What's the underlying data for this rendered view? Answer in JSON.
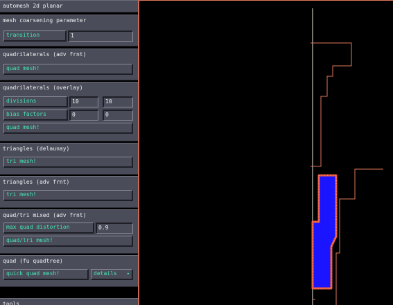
{
  "panel": {
    "title": "automesh 2d planar",
    "coarsening": {
      "title": "mesh coarsening parameter",
      "field_label": "transition",
      "field_value": "1"
    },
    "quad_adv": {
      "title": "quadrilaterals (adv frnt)",
      "button": "quad mesh!"
    },
    "quad_overlay": {
      "title": "quadrilaterals (overlay)",
      "divisions_label": "divisions",
      "divisions_1": "10",
      "divisions_2": "10",
      "bias_label": "bias factors",
      "bias_1": "0",
      "bias_2": "0",
      "button": "quad mesh!"
    },
    "tri_delaunay": {
      "title": "triangles (delaunay)",
      "button": "tri mesh!"
    },
    "tri_adv": {
      "title": "triangles (adv frnt)",
      "button": "tri mesh!"
    },
    "mixed": {
      "title": "quad/tri mixed (adv frnt)",
      "distortion_label": "max quad distortion",
      "distortion_value": "0.9",
      "button": "quad/tri mesh!"
    },
    "quadtree": {
      "title": "quad (fu quadtree)",
      "button": "quick quad mesh!",
      "details": "details"
    },
    "tools": {
      "title": "tools"
    }
  },
  "colors": {
    "panel_bg": "#4a4c5a",
    "label_text": "#46e8b4",
    "title_text": "#f2f2f2",
    "outline": "#e0785a",
    "mesh_fill": "#1a14ff",
    "mesh_nodes": "#e85a3c"
  }
}
